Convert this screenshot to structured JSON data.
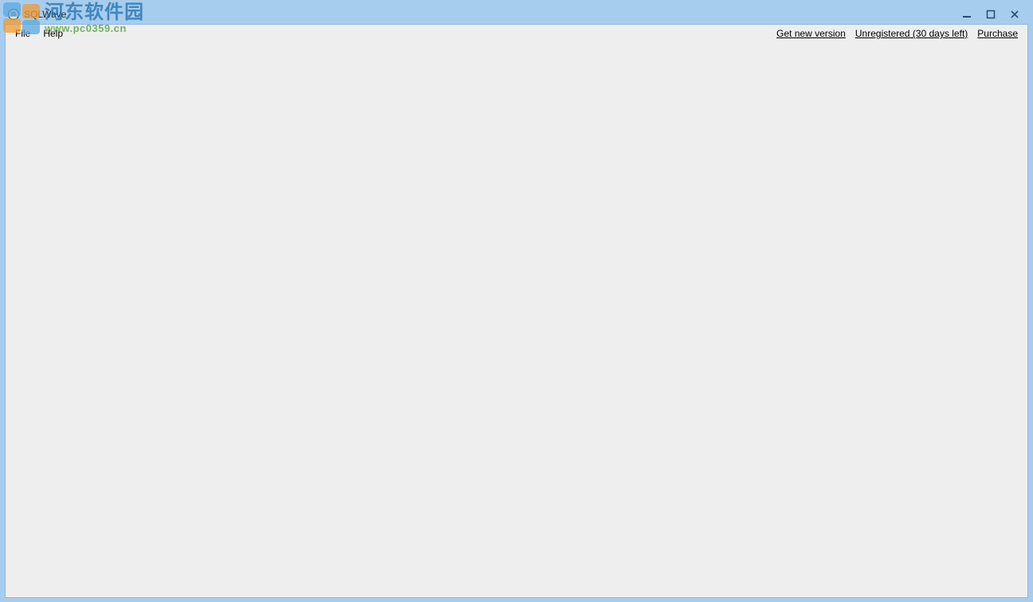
{
  "title": "SQLWave",
  "menu": {
    "file": "File",
    "help": "Help"
  },
  "links": {
    "get_new_version": "Get new version",
    "unregistered": "Unregistered (30 days left)",
    "purchase": "Purchase"
  },
  "watermark": {
    "cn": "河东软件园",
    "url": "www.pc0359.cn"
  }
}
